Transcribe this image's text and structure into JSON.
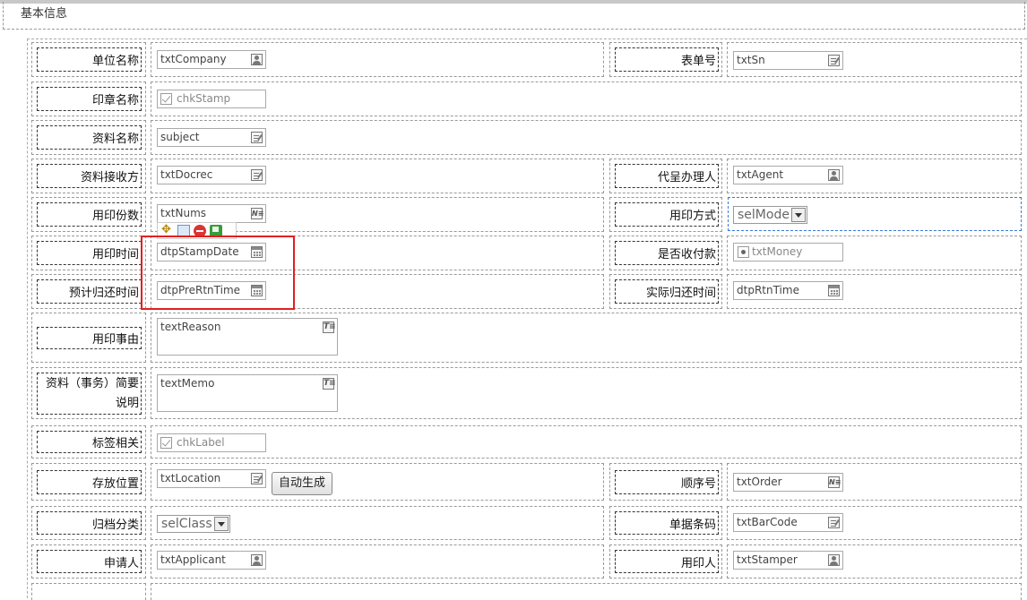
{
  "section_title": "基本信息",
  "rows": {
    "r1": {
      "label1": "单位名称",
      "ctl1": "txtCompany",
      "label2": "表单号",
      "ctl2": "txtSn"
    },
    "r2": {
      "label1": "印章名称",
      "ctl1": "chkStamp"
    },
    "r3": {
      "label1": "资料名称",
      "ctl1": "subject"
    },
    "r4": {
      "label1": "资料接收方",
      "ctl1": "txtDocrec",
      "label2": "代呈办理人",
      "ctl2": "txtAgent"
    },
    "r5": {
      "label1": "用印份数",
      "ctl1": "txtNums",
      "label2": "用印方式",
      "ctl2": "selMode"
    },
    "r6": {
      "label1": "用印时间",
      "ctl1": "dtpStampDate",
      "label2": "是否收付款",
      "ctl2": "txtMoney"
    },
    "r7": {
      "label1": "预计归还时间",
      "ctl1": "dtpPreRtnTime",
      "label2": "实际归还时间",
      "ctl2": "dtpRtnTime"
    },
    "r8": {
      "label1": "用印事由",
      "ctl1": "textReason"
    },
    "r9": {
      "label1a": "资料（事务）简要",
      "label1b": "说明",
      "ctl1": "textMemo"
    },
    "r10": {
      "label1": "标签相关",
      "ctl1": "chkLabel"
    },
    "r11": {
      "label1": "存放位置",
      "ctl1": "txtLocation",
      "button": "自动生成",
      "label2": "顺序号",
      "ctl2": "txtOrder"
    },
    "r12": {
      "label1": "归档分类",
      "ctl1": "selClass",
      "label2": "单据条码",
      "ctl2": "txtBarCode"
    },
    "r13": {
      "label1": "申请人",
      "ctl1": "txtApplicant",
      "label2": "用印人",
      "ctl2": "txtStamper"
    }
  },
  "icons": {
    "num_icon_text": "N≡",
    "text_icon_text": "T≡"
  },
  "colors": {
    "highlight": "#e02020",
    "selection": "#3b7ad8"
  }
}
